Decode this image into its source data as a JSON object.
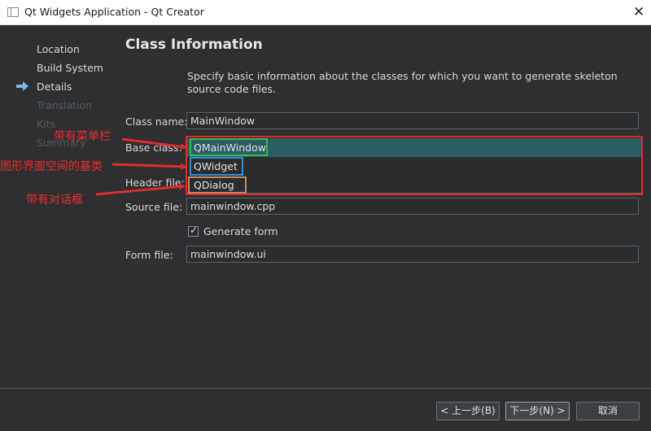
{
  "window": {
    "title": "Qt Widgets Application - Qt Creator",
    "close_glyph": "✕"
  },
  "steps": [
    {
      "label": "Location",
      "state": "done"
    },
    {
      "label": "Build System",
      "state": "done"
    },
    {
      "label": "Details",
      "state": "current"
    },
    {
      "label": "Translation",
      "state": "disabled"
    },
    {
      "label": "Kits",
      "state": "disabled"
    },
    {
      "label": "Summary",
      "state": "disabled"
    }
  ],
  "page": {
    "title": "Class Information",
    "description": "Specify basic information about the classes for which you want to generate skeleton source code files."
  },
  "form": {
    "class_name_label": "Class name:",
    "class_name_value": "MainWindow",
    "base_class_label": "Base class:",
    "base_class_options": [
      "QMainWindow",
      "QWidget",
      "QDialog"
    ],
    "base_class_selected": "QMainWindow",
    "header_file_label": "Header file:",
    "source_file_label": "Source file:",
    "source_file_value": "mainwindow.cpp",
    "generate_form_label": "Generate form",
    "generate_form_checked": true,
    "form_file_label": "Form file:",
    "form_file_value": "mainwindow.ui"
  },
  "annotations": {
    "qmainwindow_note": "带有菜单栏",
    "qwidget_note": "图形界面空间的基类",
    "qdialog_note": "带有对话框"
  },
  "buttons": {
    "back": "< 上一步(B)",
    "next": "下一步(N) >",
    "cancel": "取消"
  },
  "colors": {
    "annotation_red": "#e02a2a",
    "qmainwindow_box": "#2fbf48",
    "qwidget_box": "#2f8fd8",
    "qdialog_box": "#c8865a",
    "selection": "#2b5e64",
    "background": "#2d2f31"
  }
}
